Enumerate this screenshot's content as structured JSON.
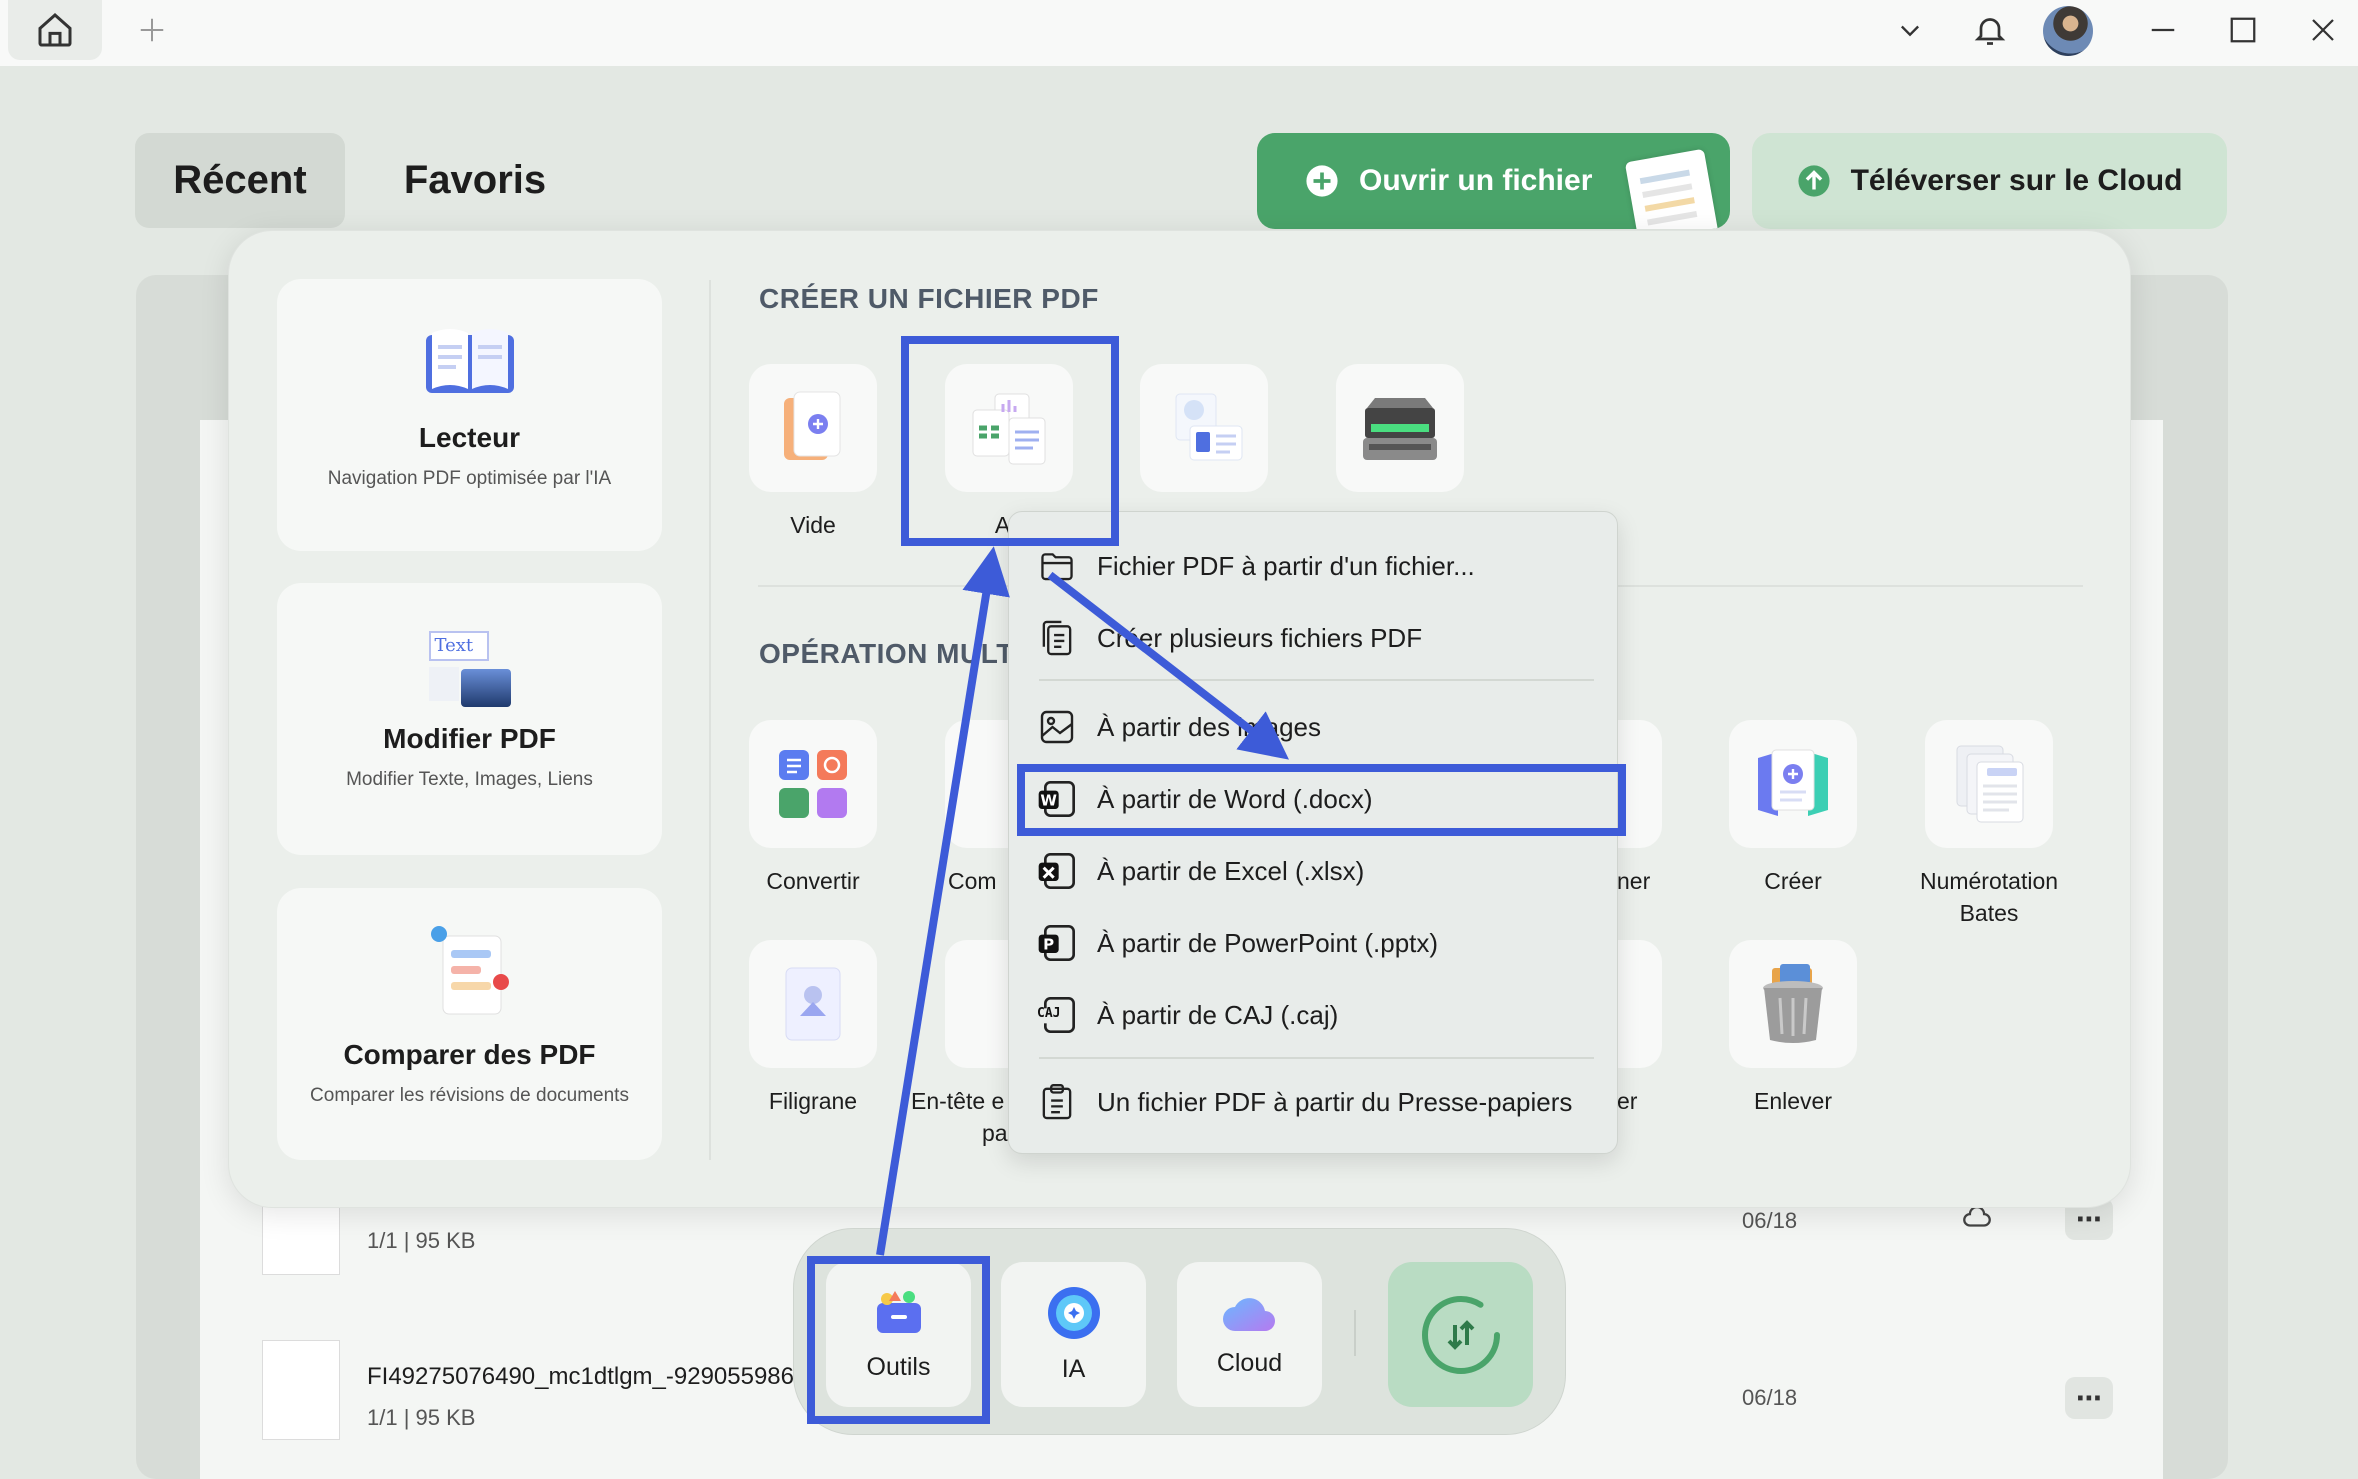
{
  "titlebar": {
    "icons": [
      "home-icon",
      "plus-icon",
      "chevron-down-icon",
      "bell-icon",
      "avatar",
      "minimize-icon",
      "maximize-icon",
      "close-icon"
    ]
  },
  "tabs": {
    "recent": "Récent",
    "favorites": "Favoris"
  },
  "actions": {
    "open_file": "Ouvrir un fichier",
    "upload_cloud": "Téléverser sur le Cloud"
  },
  "cards": [
    {
      "title": "Lecteur",
      "subtitle": "Navigation PDF optimisée par l'IA"
    },
    {
      "title": "Modifier PDF",
      "subtitle": "Modifier Texte, Images, Liens"
    },
    {
      "title": "Comparer des PDF",
      "subtitle": "Comparer les révisions de documents"
    }
  ],
  "card_badge_text": "Text",
  "create_section": {
    "title": "CRÉER UN FICHIER PDF",
    "tiles": [
      {
        "label": "Vide"
      },
      {
        "label": "Au"
      },
      {
        "label": ""
      },
      {
        "label": ""
      }
    ]
  },
  "ops_section": {
    "title": "OPÉRATION MULTI",
    "row1": [
      "Convertir",
      "Com",
      "ner",
      "Créer",
      "Numérotation Bates"
    ],
    "row2": [
      "Filigrane",
      "En-tête e",
      "pa",
      "er",
      "Enlever"
    ]
  },
  "menu": {
    "items": [
      "Fichier PDF à partir d'un fichier...",
      "Créer plusieurs fichiers PDF",
      "À partir des images",
      "À partir de Word (.docx)",
      "À partir de Excel (.xlsx)",
      "À partir de PowerPoint (.pptx)",
      "À partir de CAJ (.caj)",
      "Un fichier PDF à partir du Presse-papiers"
    ],
    "highlighted_index": 3,
    "caj_badge": "CAJ"
  },
  "files": [
    {
      "name": "",
      "meta": "1/1 | 95 KB",
      "date": "06/18"
    },
    {
      "name": "FI49275076490_mc1dtlgm_-929055986",
      "meta": "1/1 | 95 KB",
      "date": "06/18"
    }
  ],
  "dock": {
    "tools": "Outils",
    "ai": "IA",
    "cloud": "Cloud"
  },
  "colors": {
    "accent_green": "#4aa46a",
    "highlight_blue": "#3d5bd8",
    "panel_bg": "#ebefeb"
  }
}
